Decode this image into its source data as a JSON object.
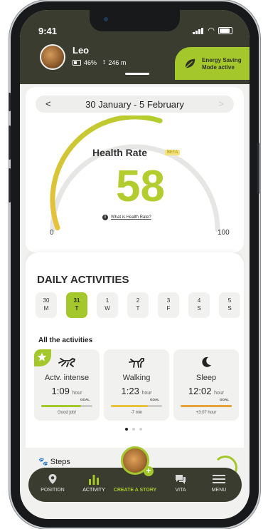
{
  "status_bar": {
    "time": "9:41"
  },
  "header": {
    "pet_name": "Leo",
    "battery": "46%",
    "distance": "246 m",
    "energy_badge": [
      "Energy Saving",
      "Mode active"
    ]
  },
  "date_range": {
    "label": "30 January - 5 February"
  },
  "health": {
    "title": "Health Rate",
    "badge": "BETA",
    "score": "58",
    "score_value": 58,
    "scale_min": "0",
    "scale_max": "100",
    "info_link": "What is Health Rate?"
  },
  "daily": {
    "title": "DAILY ACTIVITIES",
    "days": [
      {
        "num": "30",
        "letter": "M",
        "active": false
      },
      {
        "num": "31",
        "letter": "T",
        "active": true
      },
      {
        "num": "1",
        "letter": "W",
        "active": false
      },
      {
        "num": "2",
        "letter": "T",
        "active": false
      },
      {
        "num": "3",
        "letter": "F",
        "active": false
      },
      {
        "num": "4",
        "letter": "S",
        "active": false
      },
      {
        "num": "5",
        "letter": "S",
        "active": false
      }
    ],
    "all_title": "All the activities",
    "activities": [
      {
        "name": "Actv. intense",
        "value": "1:09",
        "unit": "hour",
        "goal": "GOAL",
        "note": "Good job!",
        "progress": 0.78,
        "color": "#a4c72c",
        "icon": "running-dog-icon"
      },
      {
        "name": "Walking",
        "value": "1:23",
        "unit": "hour",
        "goal": "GOAL",
        "note": "-7 min",
        "progress": 0.72,
        "color": "#e8c13a",
        "icon": "walking-dog-icon"
      },
      {
        "name": "Sleep",
        "value": "12:02",
        "unit": "hour",
        "goal": "GOAL",
        "note": "+3:07 hour",
        "progress": 1.0,
        "color": "#e8a23a",
        "icon": "moon-icon"
      }
    ]
  },
  "steps": {
    "label": "Steps"
  },
  "nav": {
    "position": "POSITION",
    "activity": "ACTIVITY",
    "story": "CREATE A STORY",
    "vita": "VITA",
    "menu": "MENU"
  },
  "colors": {
    "accent": "#a4c72c",
    "dark": "#3a3c2f",
    "gauge_start": "#e8c13a"
  }
}
